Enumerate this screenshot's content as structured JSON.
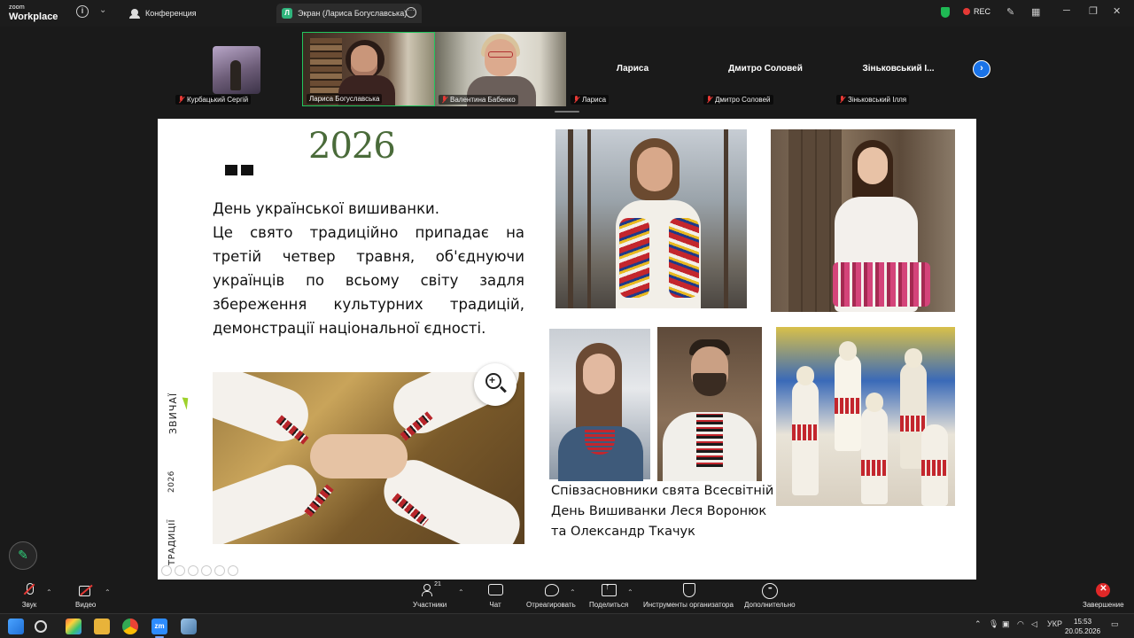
{
  "app": {
    "brand_line1": "zoom",
    "brand_line2": "Workplace",
    "tabs": [
      {
        "label": "Конференция"
      },
      {
        "label": "Экран (Лариса Богуславська)",
        "icon_text": "Л"
      }
    ],
    "rec_label": "REC"
  },
  "gallery": {
    "participants": [
      {
        "name": "Курбацький Сергій"
      },
      {
        "name": "Лариса Богуславська"
      },
      {
        "name": "Валентина Бабенко"
      },
      {
        "name": "Лариса",
        "display": "Лариса"
      },
      {
        "name": "Дмитро Соловей",
        "display": "Дмитро Соловей"
      },
      {
        "name": "Зіньковський Ілля",
        "display": "Зіньковський І..."
      }
    ]
  },
  "slide": {
    "year": "2026",
    "title_line": "День української вишиванки.",
    "body": "Це свято традиційно припадає на третій четвер травня, об'єднуючи українців по всьому світу задля збереження культурних традицій, демонстрації національної єдності.",
    "vertical_labels": [
      "ЗВИЧАЇ",
      "2026",
      "ТРАДИЦІЇ"
    ],
    "caption": "Співзасновники свята Всесвітній День Вишиванки Леся Воронюк та Олександр Ткачук"
  },
  "controls": {
    "items": [
      {
        "label": "Звук"
      },
      {
        "label": "Видео"
      },
      {
        "label": "Участники",
        "count": "21"
      },
      {
        "label": "Чат"
      },
      {
        "label": "Отреагировать"
      },
      {
        "label": "Поделиться"
      },
      {
        "label": "Инструменты организатора"
      },
      {
        "label": "Дополнительно"
      },
      {
        "label": "Завершение"
      }
    ]
  },
  "taskbar": {
    "lang": "УКР",
    "time": "15:53",
    "date": "20.05.2026"
  },
  "colors": {
    "accent_green": "#22c55e",
    "rec_red": "#e53935",
    "end_red": "#e02828",
    "year_green": "#4a6b3a",
    "next_blue": "#1a73e8"
  }
}
